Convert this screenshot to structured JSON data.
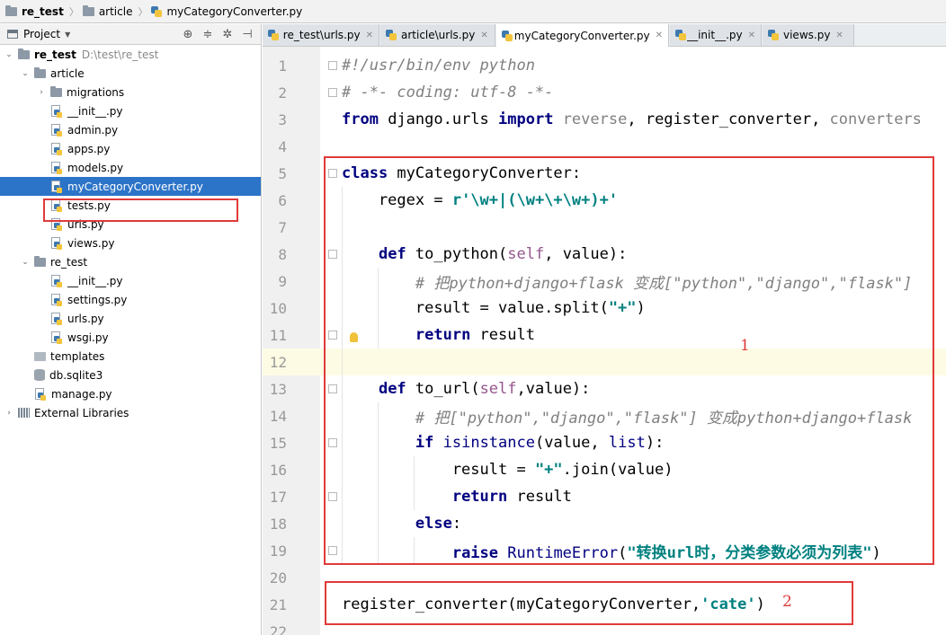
{
  "breadcrumb": {
    "items": [
      "re_test",
      "article",
      "myCategoryConverter.py"
    ]
  },
  "project_panel": {
    "title": "Project",
    "tree": [
      {
        "label": "re_test",
        "sub": "D:\\test\\re_test",
        "type": "folder",
        "expanded": true
      },
      {
        "label": "article",
        "type": "folder",
        "expanded": true
      },
      {
        "label": "migrations",
        "type": "folder",
        "expanded": false
      },
      {
        "label": "__init__.py",
        "type": "py"
      },
      {
        "label": "admin.py",
        "type": "py"
      },
      {
        "label": "apps.py",
        "type": "py"
      },
      {
        "label": "models.py",
        "type": "py"
      },
      {
        "label": "myCategoryConverter.py",
        "type": "py",
        "selected": true
      },
      {
        "label": "tests.py",
        "type": "py"
      },
      {
        "label": "urls.py",
        "type": "py"
      },
      {
        "label": "views.py",
        "type": "py"
      },
      {
        "label": "re_test",
        "type": "folder",
        "expanded": true
      },
      {
        "label": "__init__.py",
        "type": "py"
      },
      {
        "label": "settings.py",
        "type": "py"
      },
      {
        "label": "urls.py",
        "type": "py"
      },
      {
        "label": "wsgi.py",
        "type": "py"
      },
      {
        "label": "templates",
        "type": "templates"
      },
      {
        "label": "db.sqlite3",
        "type": "db"
      },
      {
        "label": "manage.py",
        "type": "py"
      },
      {
        "label": "External Libraries",
        "type": "lib",
        "expanded": false
      }
    ]
  },
  "tabs": [
    {
      "label": "re_test\\urls.py",
      "active": false
    },
    {
      "label": "article\\urls.py",
      "active": false
    },
    {
      "label": "myCategoryConverter.py",
      "active": true
    },
    {
      "label": "__init__.py",
      "active": false
    },
    {
      "label": "views.py",
      "active": false
    }
  ],
  "editor": {
    "line_numbers": [
      "1",
      "2",
      "3",
      "4",
      "5",
      "6",
      "7",
      "8",
      "9",
      "10",
      "11",
      "12",
      "13",
      "14",
      "15",
      "16",
      "17",
      "18",
      "19",
      "20",
      "21",
      "22"
    ],
    "current_line": "12",
    "code": {
      "l1": "#!/usr/bin/env python",
      "l2": "# -*- coding: utf-8 -*-",
      "l3_from": "from",
      "l3_mod": " django.urls ",
      "l3_import": "import",
      "l3_sp": " ",
      "l3_reverse": "reverse",
      "l3_comma1": ", ",
      "l3_reg": "register_converter",
      "l3_comma2": ", ",
      "l3_conv": "converters",
      "l5_class": "class",
      "l5_rest": " myCategoryConverter:",
      "l6_a": "    regex = ",
      "l6_str": "r'\\w+|(\\w+\\+\\w+)+'",
      "l8_indent": "    ",
      "l8_def": "def",
      "l8_name": " to_python(",
      "l8_self": "self",
      "l8_rest": ", value):",
      "l9": "        # 把python+django+flask 变成[\"python\",\"django\",\"flask\"]",
      "l10_a": "        result = value.split(",
      "l10_str": "\"+\"",
      "l10_b": ")",
      "l11_indent": "        ",
      "l11_kw": "return",
      "l11_rest": " result",
      "l13_indent": "    ",
      "l13_def": "def",
      "l13_name": " to_url(",
      "l13_self": "self",
      "l13_rest": ",value):",
      "l14": "        # 把[\"python\",\"django\",\"flask\"] 变成python+django+flask",
      "l15_indent": "        ",
      "l15_if": "if",
      "l15_sp": " ",
      "l15_isinst": "isinstance",
      "l15_mid": "(value, ",
      "l15_list": "list",
      "l15_end": "):",
      "l16_a": "            result = ",
      "l16_str": "\"+\"",
      "l16_b": ".join(value)",
      "l17_indent": "            ",
      "l17_kw": "return",
      "l17_rest": " result",
      "l18_indent": "        ",
      "l18_kw": "else",
      "l18_rest": ":",
      "l19_indent": "            ",
      "l19_kw": "raise",
      "l19_sp": " ",
      "l19_err": "RuntimeError",
      "l19_p1": "(",
      "l19_str": "\"转换url时，分类参数必须为列表\"",
      "l19_p2": ")",
      "l21_a": "register_converter(myCategoryConverter,",
      "l21_str": "'cate'",
      "l21_b": ")"
    },
    "annotations": {
      "box1": "1",
      "box2": "2"
    }
  },
  "colors": {
    "keyword": "#000080",
    "string": "#008080",
    "comment": "#808080",
    "annotation_red": "#e03a3a",
    "selection_blue": "#2c74c8"
  }
}
